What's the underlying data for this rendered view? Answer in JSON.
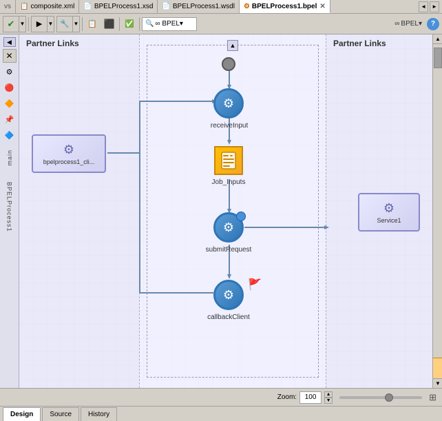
{
  "tabs": [
    {
      "id": "composite",
      "label": "composite.xml",
      "active": false,
      "icon": "📄"
    },
    {
      "id": "bpelprocess1-xsd",
      "label": "BPELProcess1.xsd",
      "active": false,
      "icon": "📄"
    },
    {
      "id": "bpelprocess1-wsdl",
      "label": "BPELProcess1.wsdl",
      "active": false,
      "icon": "📄"
    },
    {
      "id": "bpelprocess1-bpel",
      "label": "BPELProcess1.bpel",
      "active": true,
      "icon": "⚙"
    }
  ],
  "toolbar": {
    "save_label": "✔",
    "bpel_label": "∞ BPEL▾",
    "help_label": "?"
  },
  "canvas": {
    "partner_left_label": "Partner Links",
    "partner_right_label": "Partner Links",
    "process_label": "main",
    "process_label2": "BPELProcess1"
  },
  "nodes": {
    "receive": "receiveInput",
    "assign": "Job_Inputs",
    "invoke": "submitRequest",
    "callback": "callbackClient",
    "partner1": "bpelprocess1_cli...",
    "partner2": "Service1"
  },
  "statusbar": {
    "zoom_label": "Zoom:",
    "zoom_value": "100"
  },
  "bottom_tabs": [
    {
      "label": "Design",
      "active": true
    },
    {
      "label": "Source",
      "active": false
    },
    {
      "label": "History",
      "active": false
    }
  ]
}
